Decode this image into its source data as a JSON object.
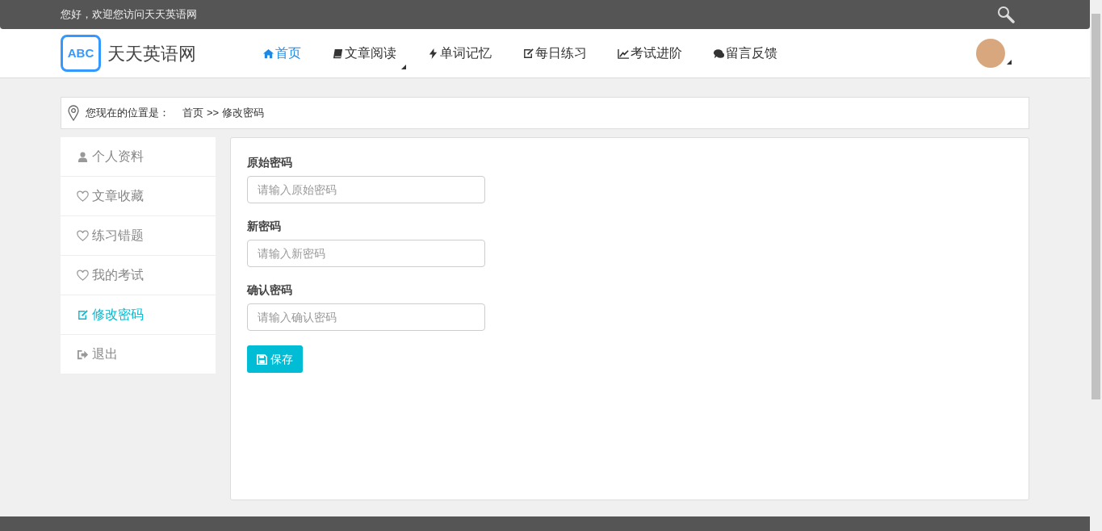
{
  "top_bar": {
    "greeting": "您好，欢迎您访问天天英语网"
  },
  "logo": {
    "badge": "ABC",
    "title": "天天英语网"
  },
  "nav": [
    {
      "label": "首页",
      "selected": true,
      "dropdown": false
    },
    {
      "label": "文章阅读",
      "selected": false,
      "dropdown": true
    },
    {
      "label": "单词记忆",
      "selected": false,
      "dropdown": false
    },
    {
      "label": "每日练习",
      "selected": false,
      "dropdown": false
    },
    {
      "label": "考试进阶",
      "selected": false,
      "dropdown": false
    },
    {
      "label": "留言反馈",
      "selected": false,
      "dropdown": false
    }
  ],
  "breadcrumb": {
    "label": "您现在的位置是：",
    "items": [
      "首页",
      ">>",
      "修改密码"
    ]
  },
  "sidebar": {
    "items": [
      {
        "label": "个人资料",
        "selected": false
      },
      {
        "label": "文章收藏",
        "selected": false
      },
      {
        "label": "练习错题",
        "selected": false
      },
      {
        "label": "我的考试",
        "selected": false
      },
      {
        "label": "修改密码",
        "selected": true
      },
      {
        "label": "退出",
        "selected": false
      }
    ]
  },
  "form": {
    "fields": [
      {
        "label": "原始密码",
        "placeholder": "请输入原始密码"
      },
      {
        "label": "新密码",
        "placeholder": "请输入新密码"
      },
      {
        "label": "确认密码",
        "placeholder": "请输入确认密码"
      }
    ],
    "save_button": "保存"
  }
}
